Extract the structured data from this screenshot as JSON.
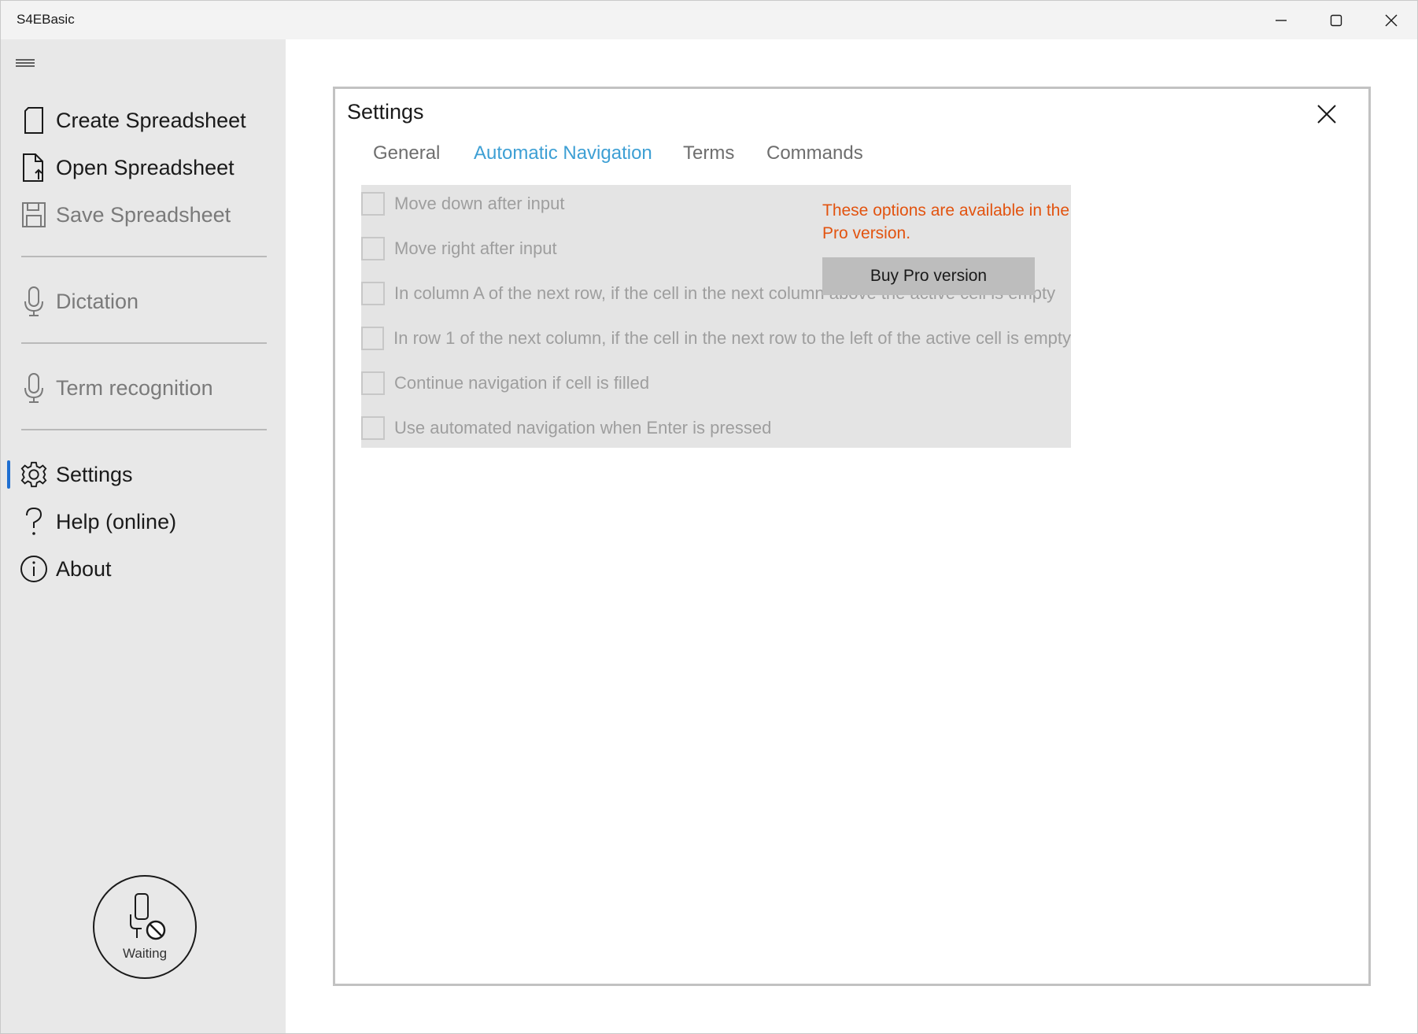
{
  "window": {
    "title": "S4EBasic"
  },
  "sidebar": {
    "items": [
      {
        "label": "Create Spreadsheet",
        "icon": "new-document-icon"
      },
      {
        "label": "Open Spreadsheet",
        "icon": "open-document-icon"
      },
      {
        "label": "Save Spreadsheet",
        "icon": "save-icon"
      },
      {
        "label": "Dictation",
        "icon": "microphone-icon"
      },
      {
        "label": "Term recognition",
        "icon": "microphone-icon"
      },
      {
        "label": "Settings",
        "icon": "gear-icon"
      },
      {
        "label": "Help (online)",
        "icon": "question-icon"
      },
      {
        "label": "About",
        "icon": "info-icon"
      }
    ],
    "mic_status": "Waiting"
  },
  "settings": {
    "title": "Settings",
    "tabs": [
      {
        "label": "General"
      },
      {
        "label": "Automatic Navigation",
        "active": true
      },
      {
        "label": "Terms"
      },
      {
        "label": "Commands"
      }
    ],
    "options": [
      "Move down after input",
      "Move right after input",
      "In column A of the next row, if the cell in the next column above the active cell is empty",
      "In row 1 of the next column, if the cell in the next row to the left of the active cell is empty",
      "Continue navigation if cell is filled",
      "Use automated navigation when Enter is pressed"
    ],
    "pro_note": "These options are available in the Pro version.",
    "buy_button": "Buy Pro version"
  },
  "colors": {
    "accent_tab": "#3d9fd4",
    "pro_note": "#e2530f",
    "active_indicator": "#1f6fd1"
  }
}
